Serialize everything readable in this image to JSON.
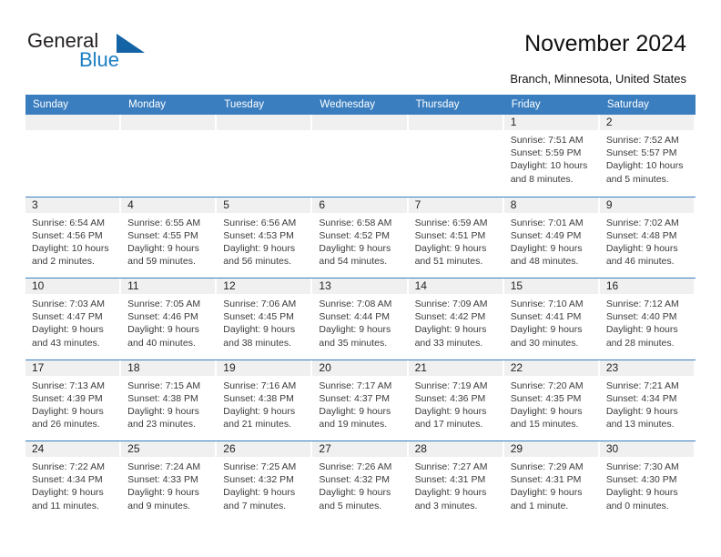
{
  "brand": {
    "word1": "General",
    "word2": "Blue",
    "triangle_color": "#1464a5",
    "blue_text_color": "#1b7fc4"
  },
  "header": {
    "title": "November 2024",
    "subtitle": "Branch, Minnesota, United States"
  },
  "theme": {
    "header_row_bg": "#3a7ebf",
    "date_band_bg": "#f0f0f0",
    "text_color": "#3b3b3b"
  },
  "weekdays": [
    "Sunday",
    "Monday",
    "Tuesday",
    "Wednesday",
    "Thursday",
    "Friday",
    "Saturday"
  ],
  "weeks": [
    [
      {
        "day": "",
        "lines": []
      },
      {
        "day": "",
        "lines": []
      },
      {
        "day": "",
        "lines": []
      },
      {
        "day": "",
        "lines": []
      },
      {
        "day": "",
        "lines": []
      },
      {
        "day": "1",
        "lines": [
          "Sunrise: 7:51 AM",
          "Sunset: 5:59 PM",
          "Daylight: 10 hours",
          "and 8 minutes."
        ]
      },
      {
        "day": "2",
        "lines": [
          "Sunrise: 7:52 AM",
          "Sunset: 5:57 PM",
          "Daylight: 10 hours",
          "and 5 minutes."
        ]
      }
    ],
    [
      {
        "day": "3",
        "lines": [
          "Sunrise: 6:54 AM",
          "Sunset: 4:56 PM",
          "Daylight: 10 hours",
          "and 2 minutes."
        ]
      },
      {
        "day": "4",
        "lines": [
          "Sunrise: 6:55 AM",
          "Sunset: 4:55 PM",
          "Daylight: 9 hours",
          "and 59 minutes."
        ]
      },
      {
        "day": "5",
        "lines": [
          "Sunrise: 6:56 AM",
          "Sunset: 4:53 PM",
          "Daylight: 9 hours",
          "and 56 minutes."
        ]
      },
      {
        "day": "6",
        "lines": [
          "Sunrise: 6:58 AM",
          "Sunset: 4:52 PM",
          "Daylight: 9 hours",
          "and 54 minutes."
        ]
      },
      {
        "day": "7",
        "lines": [
          "Sunrise: 6:59 AM",
          "Sunset: 4:51 PM",
          "Daylight: 9 hours",
          "and 51 minutes."
        ]
      },
      {
        "day": "8",
        "lines": [
          "Sunrise: 7:01 AM",
          "Sunset: 4:49 PM",
          "Daylight: 9 hours",
          "and 48 minutes."
        ]
      },
      {
        "day": "9",
        "lines": [
          "Sunrise: 7:02 AM",
          "Sunset: 4:48 PM",
          "Daylight: 9 hours",
          "and 46 minutes."
        ]
      }
    ],
    [
      {
        "day": "10",
        "lines": [
          "Sunrise: 7:03 AM",
          "Sunset: 4:47 PM",
          "Daylight: 9 hours",
          "and 43 minutes."
        ]
      },
      {
        "day": "11",
        "lines": [
          "Sunrise: 7:05 AM",
          "Sunset: 4:46 PM",
          "Daylight: 9 hours",
          "and 40 minutes."
        ]
      },
      {
        "day": "12",
        "lines": [
          "Sunrise: 7:06 AM",
          "Sunset: 4:45 PM",
          "Daylight: 9 hours",
          "and 38 minutes."
        ]
      },
      {
        "day": "13",
        "lines": [
          "Sunrise: 7:08 AM",
          "Sunset: 4:44 PM",
          "Daylight: 9 hours",
          "and 35 minutes."
        ]
      },
      {
        "day": "14",
        "lines": [
          "Sunrise: 7:09 AM",
          "Sunset: 4:42 PM",
          "Daylight: 9 hours",
          "and 33 minutes."
        ]
      },
      {
        "day": "15",
        "lines": [
          "Sunrise: 7:10 AM",
          "Sunset: 4:41 PM",
          "Daylight: 9 hours",
          "and 30 minutes."
        ]
      },
      {
        "day": "16",
        "lines": [
          "Sunrise: 7:12 AM",
          "Sunset: 4:40 PM",
          "Daylight: 9 hours",
          "and 28 minutes."
        ]
      }
    ],
    [
      {
        "day": "17",
        "lines": [
          "Sunrise: 7:13 AM",
          "Sunset: 4:39 PM",
          "Daylight: 9 hours",
          "and 26 minutes."
        ]
      },
      {
        "day": "18",
        "lines": [
          "Sunrise: 7:15 AM",
          "Sunset: 4:38 PM",
          "Daylight: 9 hours",
          "and 23 minutes."
        ]
      },
      {
        "day": "19",
        "lines": [
          "Sunrise: 7:16 AM",
          "Sunset: 4:38 PM",
          "Daylight: 9 hours",
          "and 21 minutes."
        ]
      },
      {
        "day": "20",
        "lines": [
          "Sunrise: 7:17 AM",
          "Sunset: 4:37 PM",
          "Daylight: 9 hours",
          "and 19 minutes."
        ]
      },
      {
        "day": "21",
        "lines": [
          "Sunrise: 7:19 AM",
          "Sunset: 4:36 PM",
          "Daylight: 9 hours",
          "and 17 minutes."
        ]
      },
      {
        "day": "22",
        "lines": [
          "Sunrise: 7:20 AM",
          "Sunset: 4:35 PM",
          "Daylight: 9 hours",
          "and 15 minutes."
        ]
      },
      {
        "day": "23",
        "lines": [
          "Sunrise: 7:21 AM",
          "Sunset: 4:34 PM",
          "Daylight: 9 hours",
          "and 13 minutes."
        ]
      }
    ],
    [
      {
        "day": "24",
        "lines": [
          "Sunrise: 7:22 AM",
          "Sunset: 4:34 PM",
          "Daylight: 9 hours",
          "and 11 minutes."
        ]
      },
      {
        "day": "25",
        "lines": [
          "Sunrise: 7:24 AM",
          "Sunset: 4:33 PM",
          "Daylight: 9 hours",
          "and 9 minutes."
        ]
      },
      {
        "day": "26",
        "lines": [
          "Sunrise: 7:25 AM",
          "Sunset: 4:32 PM",
          "Daylight: 9 hours",
          "and 7 minutes."
        ]
      },
      {
        "day": "27",
        "lines": [
          "Sunrise: 7:26 AM",
          "Sunset: 4:32 PM",
          "Daylight: 9 hours",
          "and 5 minutes."
        ]
      },
      {
        "day": "28",
        "lines": [
          "Sunrise: 7:27 AM",
          "Sunset: 4:31 PM",
          "Daylight: 9 hours",
          "and 3 minutes."
        ]
      },
      {
        "day": "29",
        "lines": [
          "Sunrise: 7:29 AM",
          "Sunset: 4:31 PM",
          "Daylight: 9 hours",
          "and 1 minute."
        ]
      },
      {
        "day": "30",
        "lines": [
          "Sunrise: 7:30 AM",
          "Sunset: 4:30 PM",
          "Daylight: 9 hours",
          "and 0 minutes."
        ]
      }
    ]
  ]
}
